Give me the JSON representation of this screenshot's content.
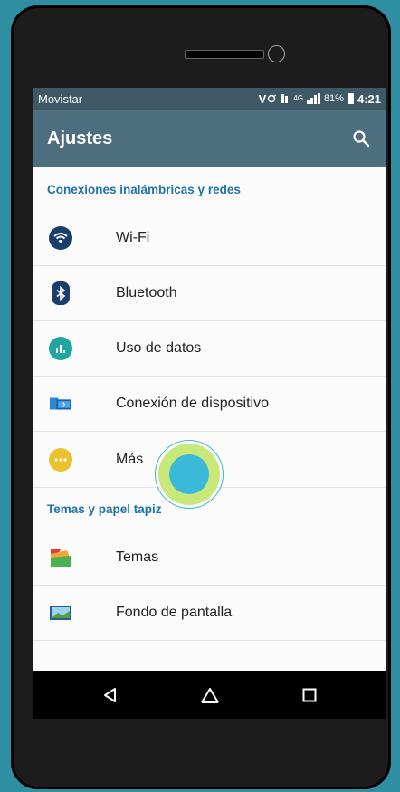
{
  "statusbar": {
    "carrier": "Movistar",
    "volte": "V",
    "network_type": "4G",
    "battery_percent": "81%",
    "time": "4:21"
  },
  "appbar": {
    "title": "Ajustes",
    "search_icon": "search-icon"
  },
  "sections": [
    {
      "header": "Conexiones inalámbricas y redes",
      "items": [
        {
          "label": "Wi-Fi",
          "icon": "wifi-icon",
          "color": "#1a3d6b"
        },
        {
          "label": "Bluetooth",
          "icon": "bluetooth-icon",
          "color": "#1a3d6b"
        },
        {
          "label": "Uso de datos",
          "icon": "data-usage-icon",
          "color": "#1fa79f"
        },
        {
          "label": "Conexión de dispositivo",
          "icon": "device-connection-icon",
          "color": "#2b86d6"
        },
        {
          "label": "Más",
          "icon": "more-icon",
          "color": "#e9c22d"
        }
      ]
    },
    {
      "header": "Temas y papel tapiz",
      "items": [
        {
          "label": "Temas",
          "icon": "themes-icon"
        },
        {
          "label": "Fondo de pantalla",
          "icon": "wallpaper-icon"
        }
      ]
    }
  ],
  "navbar": {
    "back_icon": "back-icon",
    "home_icon": "home-icon",
    "recents_icon": "recents-icon"
  },
  "colors": {
    "background": "#2f8fa2",
    "statusbar": "#3e5866",
    "appbar": "#4c6e7e",
    "section_header": "#1f73a8",
    "touch_indicator": "#3bb9d8"
  }
}
